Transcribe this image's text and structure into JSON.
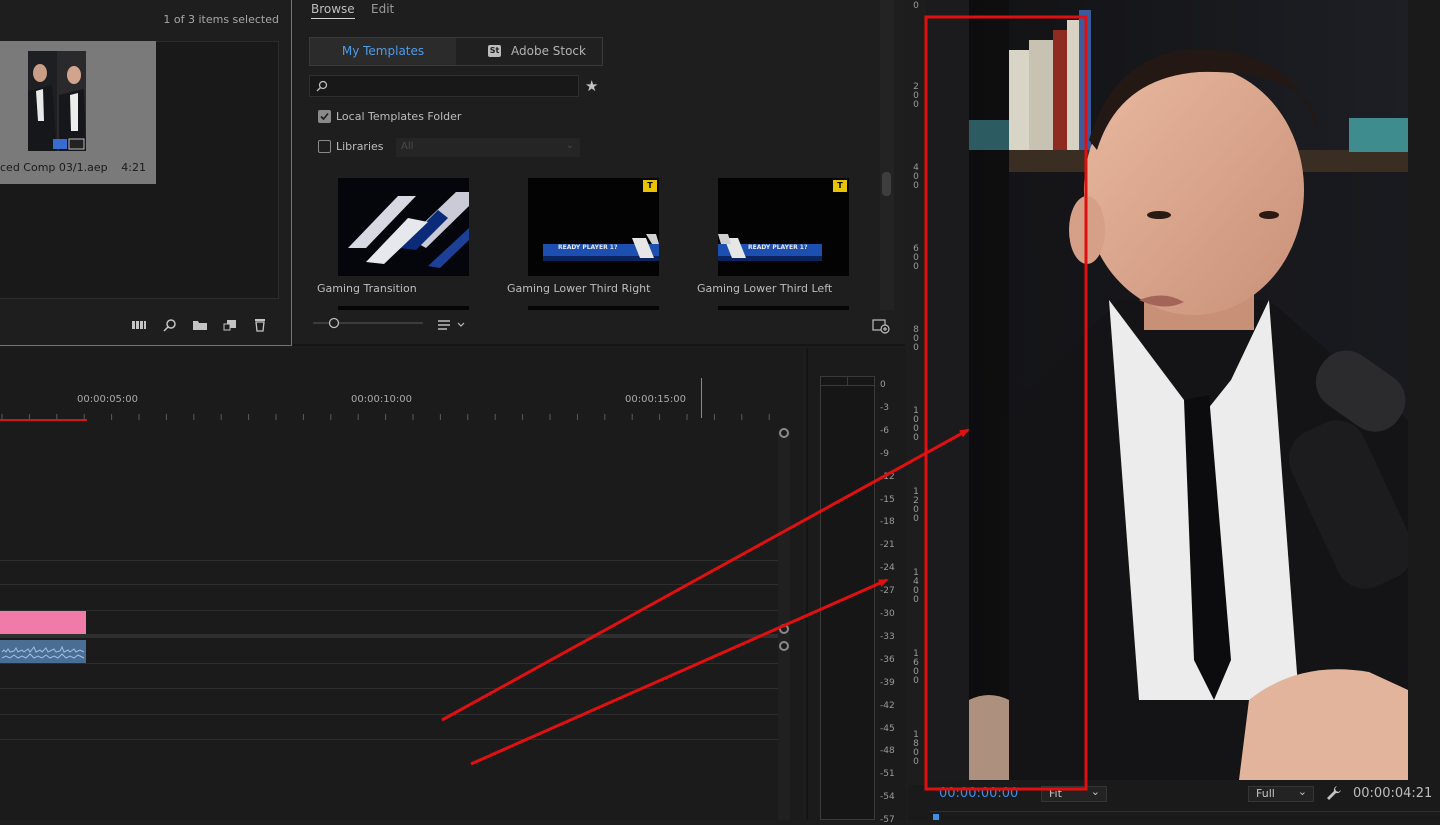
{
  "project": {
    "selection_status": "1 of 3 items selected",
    "clip": {
      "name": "ced Comp 03/1.aep",
      "duration": "4:21"
    },
    "toolbar_icons": [
      "list-view-icon",
      "find-icon",
      "new-bin-icon",
      "new-item-icon",
      "trash-icon"
    ]
  },
  "essential_graphics": {
    "tabs": {
      "browse": "Browse",
      "edit": "Edit"
    },
    "active_tab": "Browse",
    "source": {
      "my_templates": "My Templates",
      "adobe_stock": "Adobe Stock",
      "stock_badge": "St"
    },
    "search": {
      "placeholder": ""
    },
    "local_templates_folder": {
      "label": "Local Templates Folder",
      "checked": true
    },
    "libraries": {
      "label": "Libraries",
      "checked": false,
      "select_value": "All"
    },
    "templates": [
      {
        "label": "Gaming Transition",
        "badge": ""
      },
      {
        "label": "Gaming Lower Third Right",
        "badge": "T",
        "banner_text": "READY PLAYER 1?"
      },
      {
        "label": "Gaming Lower Third Left",
        "badge": "T",
        "banner_text": "READY PLAYER 1?"
      }
    ]
  },
  "timeline": {
    "timecodes": [
      "00:00:05:00",
      "00:00:10:00",
      "00:00:15:00"
    ],
    "clip_color": "#f07aa8",
    "audio_color": "#4a6d93"
  },
  "audio_meter": {
    "db_scale": [
      "0",
      "-3",
      "-6",
      "-9",
      "-12",
      "-15",
      "-18",
      "-21",
      "-24",
      "-27",
      "-30",
      "-33",
      "-36",
      "-39",
      "-42",
      "-45",
      "-48",
      "-51",
      "-54",
      "-57"
    ]
  },
  "program_monitor": {
    "vertical_ruler": [
      "0",
      "200",
      "400",
      "600",
      "800",
      "1000",
      "1200",
      "1400",
      "1600",
      "1800"
    ],
    "current_timecode": "00:00:00:00",
    "zoom": "Fit",
    "resolution": "Full",
    "duration": "00:00:04:21",
    "accent_color": "#3d8fe6"
  },
  "annotation": {
    "color": "#e01010"
  }
}
